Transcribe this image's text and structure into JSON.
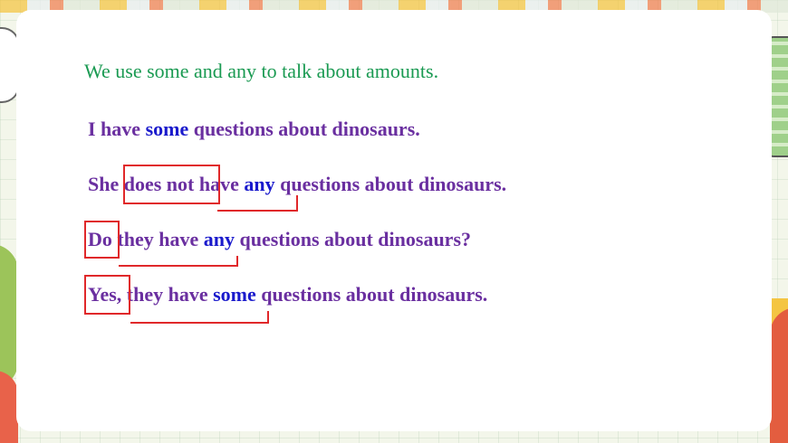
{
  "intro": "We use some and any to talk about amounts.",
  "sentences": [
    {
      "parts": [
        "I have ",
        "some",
        " questions about dinosaurs."
      ]
    },
    {
      "parts": [
        "She ",
        "does not",
        " have ",
        "any",
        " questions about dinosaurs."
      ]
    },
    {
      "parts": [
        "Do",
        " they have ",
        "any",
        " questions about dinosaurs?"
      ]
    },
    {
      "parts": [
        "Yes,",
        " they have ",
        "some",
        " questions about dinosaurs."
      ]
    }
  ],
  "colors": {
    "intro": "#1a9a52",
    "sentence": "#6a2fa0",
    "keyword": "#1a1acc",
    "annotation": "#e0282a"
  }
}
